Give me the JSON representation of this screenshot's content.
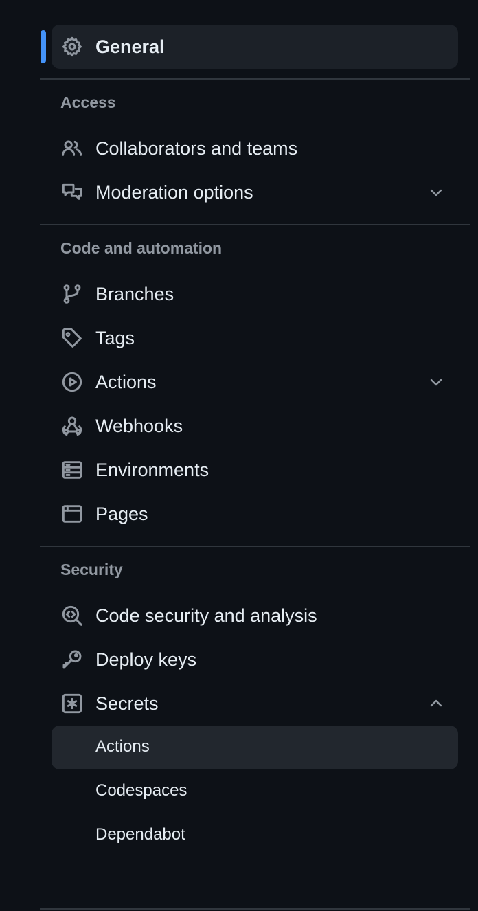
{
  "nav": {
    "general": {
      "label": "General",
      "icon": "gear-icon",
      "active": true
    },
    "accent_color": "#4493f8",
    "sections": [
      {
        "title": "Access",
        "items": [
          {
            "label": "Collaborators and teams",
            "icon": "people-icon",
            "expandable": false
          },
          {
            "label": "Moderation options",
            "icon": "comment-discussion-icon",
            "expandable": true,
            "expanded": false
          }
        ]
      },
      {
        "title": "Code and automation",
        "items": [
          {
            "label": "Branches",
            "icon": "git-branch-icon",
            "expandable": false
          },
          {
            "label": "Tags",
            "icon": "tag-icon",
            "expandable": false
          },
          {
            "label": "Actions",
            "icon": "play-icon",
            "expandable": true,
            "expanded": false
          },
          {
            "label": "Webhooks",
            "icon": "webhook-icon",
            "expandable": false
          },
          {
            "label": "Environments",
            "icon": "server-icon",
            "expandable": false
          },
          {
            "label": "Pages",
            "icon": "browser-icon",
            "expandable": false
          }
        ]
      },
      {
        "title": "Security",
        "items": [
          {
            "label": "Code security and analysis",
            "icon": "codescan-icon",
            "expandable": false
          },
          {
            "label": "Deploy keys",
            "icon": "key-icon",
            "expandable": false
          },
          {
            "label": "Secrets",
            "icon": "key-asterisk-icon",
            "expandable": true,
            "expanded": true,
            "children": [
              {
                "label": "Actions",
                "selected": true
              },
              {
                "label": "Codespaces",
                "selected": false
              },
              {
                "label": "Dependabot",
                "selected": false
              }
            ]
          }
        ]
      }
    ]
  }
}
